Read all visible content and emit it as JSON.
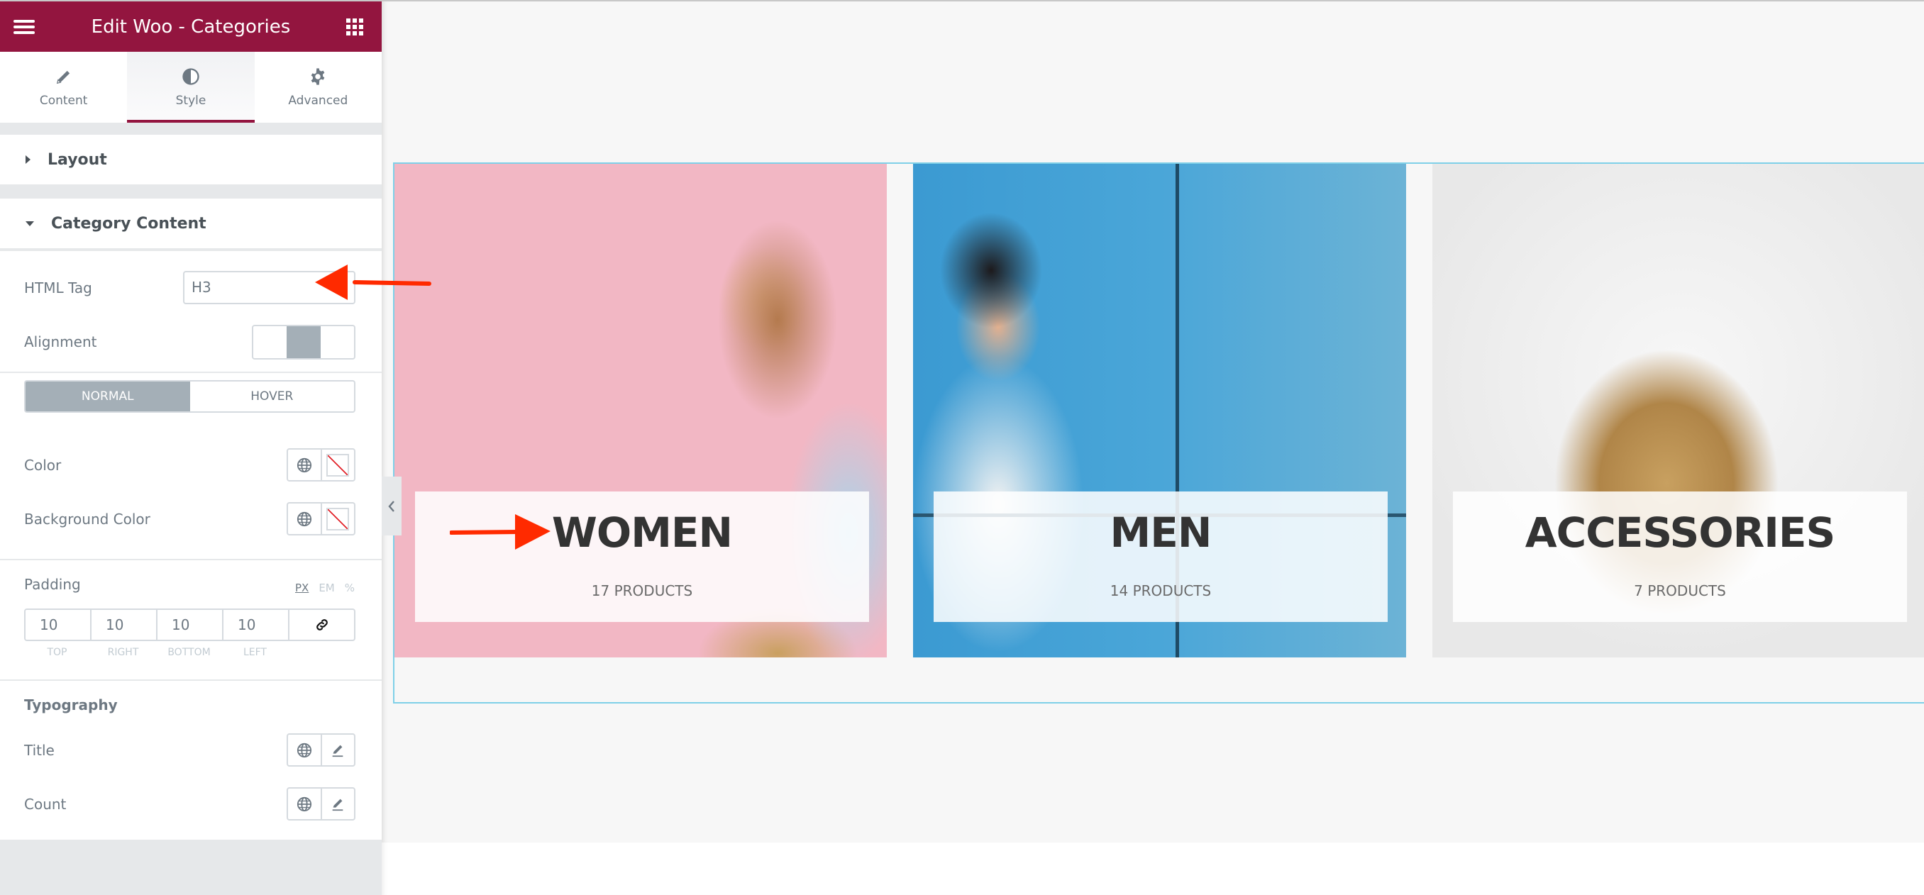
{
  "editor": {
    "title": "Edit Woo - Categories",
    "brand_color": "#93153f",
    "tabs": [
      {
        "label": "Content",
        "icon": "pencil-icon",
        "active": false
      },
      {
        "label": "Style",
        "icon": "half-circle-icon",
        "active": true
      },
      {
        "label": "Advanced",
        "icon": "gear-icon",
        "active": false
      }
    ]
  },
  "sections": {
    "layout": {
      "label": "Layout",
      "expanded": false
    },
    "category_content": {
      "label": "Category Content",
      "expanded": true
    }
  },
  "controls": {
    "html_tag": {
      "label": "HTML Tag",
      "value": "H3"
    },
    "alignment": {
      "label": "Alignment",
      "selected": "center"
    },
    "state_toggle": {
      "normal": "NORMAL",
      "hover": "HOVER",
      "selected": "NORMAL"
    },
    "color": {
      "label": "Color"
    },
    "background_color": {
      "label": "Background Color"
    },
    "padding": {
      "label": "Padding",
      "units": [
        "PX",
        "EM",
        "%"
      ],
      "selected_unit": "PX",
      "values": {
        "top": "10",
        "right": "10",
        "bottom": "10",
        "left": "10"
      },
      "labels": {
        "top": "TOP",
        "right": "RIGHT",
        "bottom": "BOTTOM",
        "left": "LEFT"
      },
      "linked": true
    },
    "typography": {
      "heading": "Typography",
      "title_label": "Title",
      "count_label": "Count"
    }
  },
  "canvas": {
    "categories": [
      {
        "title": "WOMEN",
        "count": "17 PRODUCTS"
      },
      {
        "title": "MEN",
        "count": "14 PRODUCTS"
      },
      {
        "title": "ACCESSORIES",
        "count": "7 PRODUCTS"
      }
    ],
    "annotation_color": "#ff2a00"
  }
}
